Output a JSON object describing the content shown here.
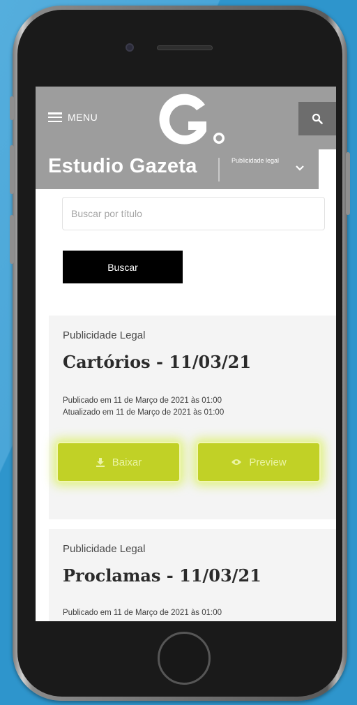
{
  "header": {
    "menu_label": "MENU",
    "brand": "Estudio Gazeta",
    "section_label": "Publicidade legal"
  },
  "search": {
    "placeholder": "Buscar por título",
    "value": "",
    "button_label": "Buscar"
  },
  "cards": [
    {
      "category": "Publicidade Legal",
      "title": "Cartórios - 11/03/21",
      "published": "Publicado em 11 de Março de 2021 às 01:00",
      "updated": "Atualizado em 11 de Março de 2021 às 01:00",
      "download_label": "Baixar",
      "preview_label": "Preview"
    },
    {
      "category": "Publicidade Legal",
      "title": "Proclamas - 11/03/21",
      "published": "Publicado em 11 de Março de 2021 às 01:00"
    }
  ],
  "colors": {
    "header_bg": "#9d9d9d",
    "accent": "#c1d126",
    "background": "#2e95cc"
  },
  "icons": {
    "menu": "hamburger-icon",
    "search": "search-icon",
    "chevron": "chevron-down-icon",
    "download": "download-icon",
    "preview": "eye-icon"
  }
}
